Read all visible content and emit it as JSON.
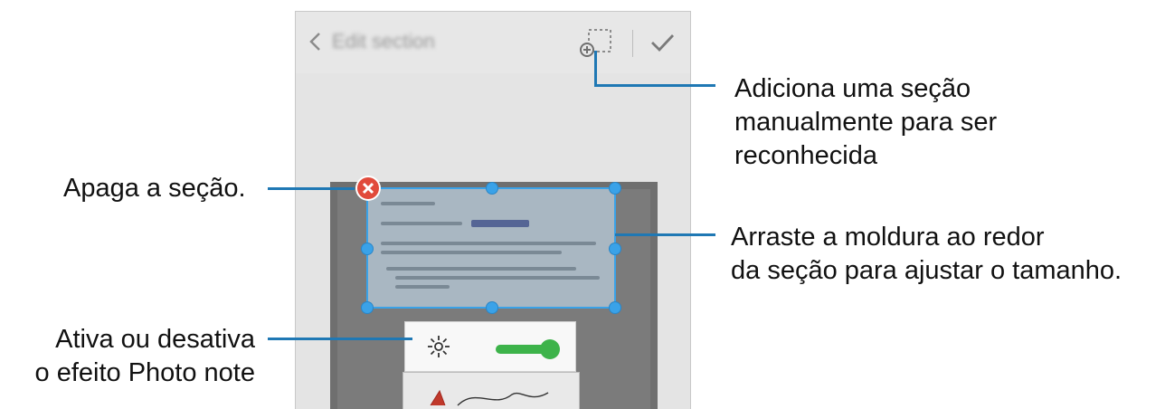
{
  "screen": {
    "title": "Edit section",
    "icons": {
      "back": "chevron-left-icon",
      "add_section": "add-section-icon",
      "confirm": "check-icon",
      "delete": "delete-icon",
      "photo_effect": "sun-icon"
    },
    "photo_note_toggle": {
      "on": true
    }
  },
  "callouts": {
    "add_section": [
      "Adiciona uma seção",
      "manualmente para ser",
      "reconhecida"
    ],
    "delete": [
      "Apaga a seção."
    ],
    "drag_frame": [
      "Arraste a moldura ao redor",
      "da seção para ajustar o tamanho."
    ],
    "photo_note": [
      "Ativa ou desativa",
      "o efeito Photo note"
    ]
  },
  "colors": {
    "callout_line": "#1f78b4",
    "frame": "#3aa2e8",
    "toggle_on": "#3db34a",
    "delete": "#e14a3b"
  }
}
